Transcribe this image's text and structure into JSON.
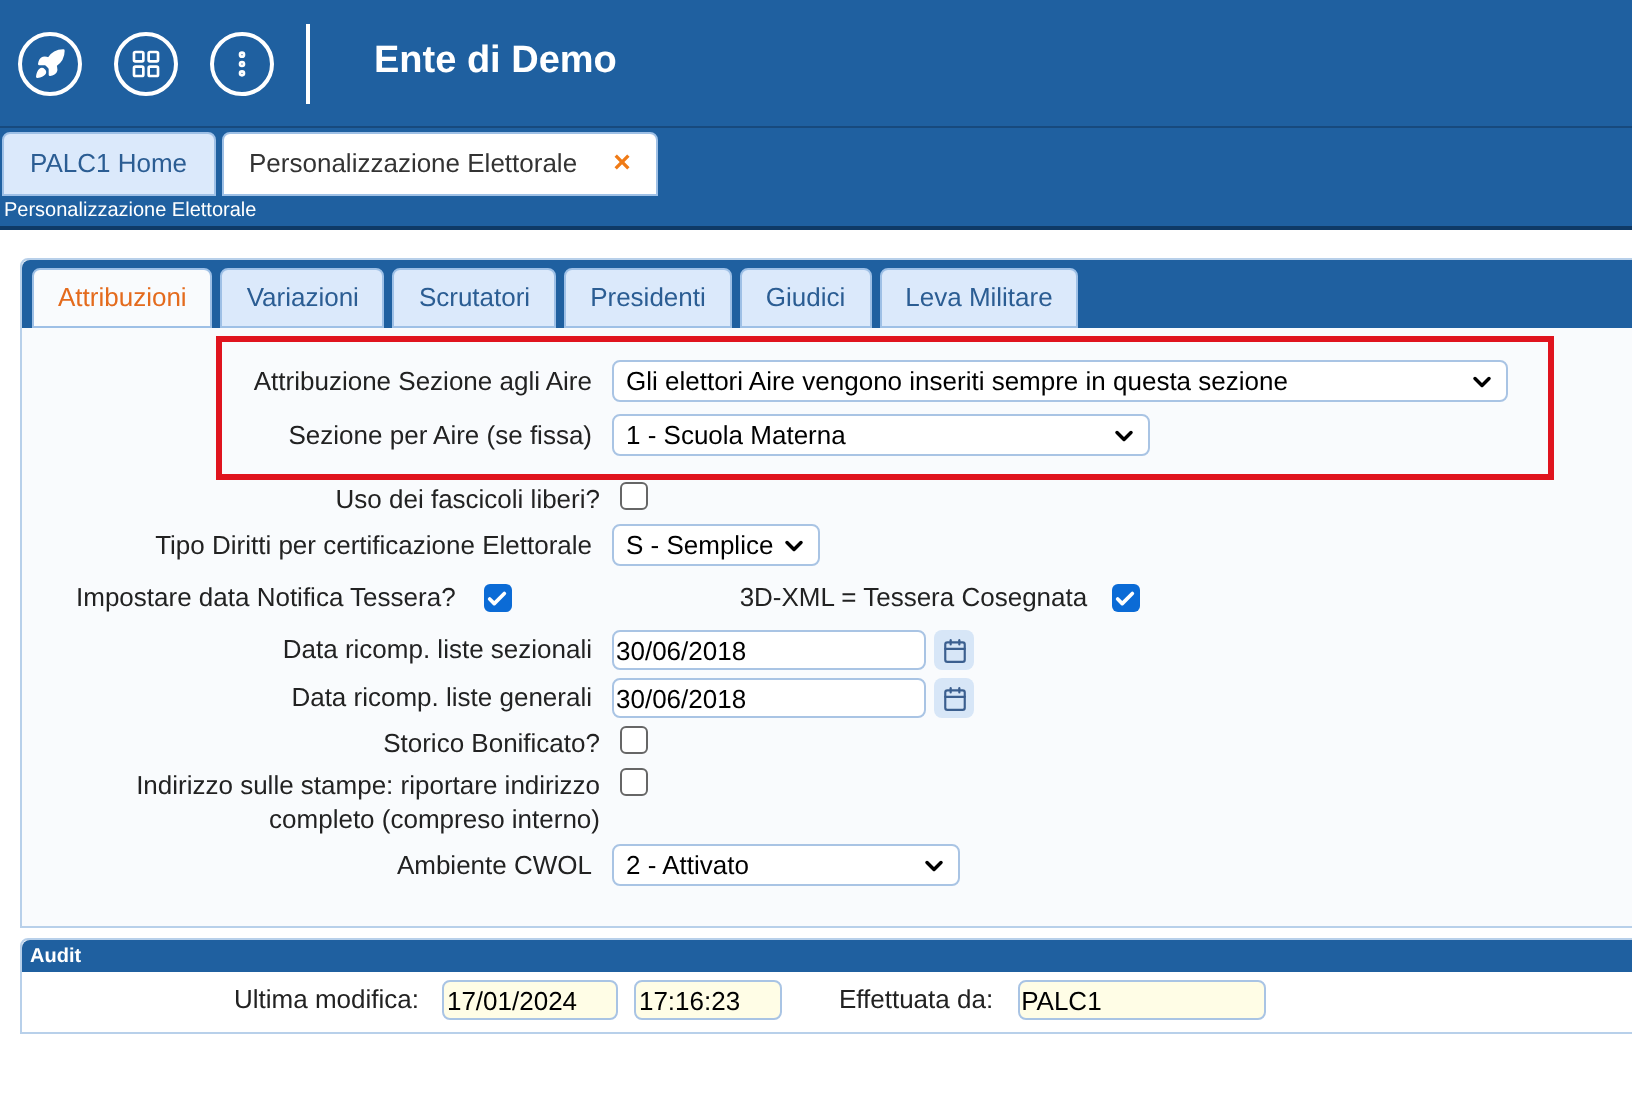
{
  "header": {
    "title": "Ente di Demo"
  },
  "tabs": [
    {
      "label": "PALC1 Home",
      "selected": false
    },
    {
      "label": "Personalizzazione Elettorale",
      "selected": true,
      "close": "×"
    }
  ],
  "breadcrumb": "Personalizzazione Elettorale",
  "form_tabs": [
    {
      "label": "Attribuzioni",
      "selected": true
    },
    {
      "label": "Variazioni",
      "selected": false
    },
    {
      "label": "Scrutatori",
      "selected": false
    },
    {
      "label": "Presidenti",
      "selected": false
    },
    {
      "label": "Giudici",
      "selected": false
    },
    {
      "label": "Leva Militare",
      "selected": false
    }
  ],
  "highlighted_fields": [
    {
      "kind": "select",
      "label": "Attribuzione Sezione agli Aire",
      "value": "Gli elettori Aire vengono inseriti sempre in questa sezione"
    },
    {
      "kind": "select",
      "label": "Sezione per Aire (se fissa)",
      "value": "1 - Scuola Materna"
    }
  ],
  "fields": [
    {
      "kind": "checkbox",
      "label": "Uso dei fascicoli liberi?",
      "checked": false
    },
    {
      "kind": "select",
      "label": "Tipo Diritti per certificazione Elettorale",
      "value": "S - Semplice"
    },
    {
      "kind": "pair",
      "label": "Impostare data Notifica Tessera?",
      "checked": true,
      "label_2": "3D-XML = Tessera Cosegnata",
      "checked_2": true
    },
    {
      "kind": "date",
      "label": "Data ricomp. liste sezionali",
      "value": "30/06/2018"
    },
    {
      "kind": "date",
      "label": "Data ricomp. liste generali",
      "value": "30/06/2018"
    },
    {
      "kind": "checkbox",
      "label": "Storico Bonificato?",
      "checked": false
    },
    {
      "kind": "checkbox",
      "label": "Indirizzo sulle stampe: riportare indirizzo completo (compreso interno)",
      "checked": false
    },
    {
      "kind": "select",
      "label": "Ambiente CWOL",
      "value": "2 - Attivato"
    }
  ],
  "audit": {
    "title": "Audit",
    "modified_label": "Ultima modifica:",
    "date": "17/01/2024",
    "time": "17:16:23",
    "by_label": "Effettuata da:",
    "by": "PALC1"
  }
}
